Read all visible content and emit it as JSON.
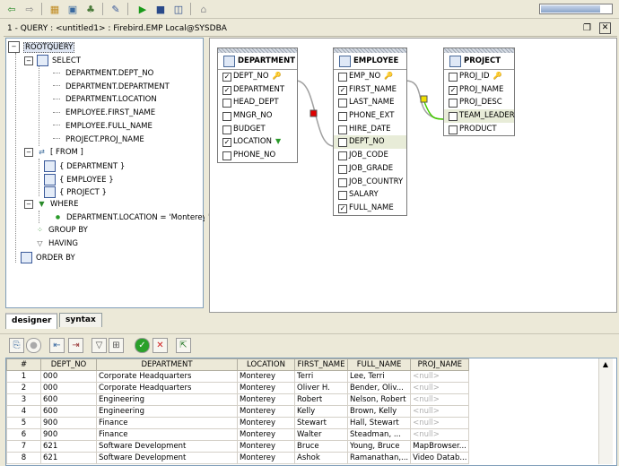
{
  "toolbar": {
    "icons": [
      "back-arrow-icon",
      "forward-arrow-icon",
      "open-folder-icon",
      "image-icon",
      "tree-icon",
      "wrench-icon",
      "run-icon",
      "save-icon",
      "save-all-icon",
      "lock-icon"
    ],
    "progress": 0.85
  },
  "query_title": "1 - QUERY : <untitled1> : Firebird.EMP Local@SYSDBA",
  "tree": {
    "root": "ROOTQUERY",
    "select_label": "SELECT",
    "select_items": [
      "DEPARTMENT.DEPT_NO",
      "DEPARTMENT.DEPARTMENT",
      "DEPARTMENT.LOCATION",
      "EMPLOYEE.FIRST_NAME",
      "EMPLOYEE.FULL_NAME",
      "PROJECT.PROJ_NAME"
    ],
    "from_label": "[ FROM ]",
    "from_items": [
      "{ DEPARTMENT }",
      "{ EMPLOYEE }",
      "{ PROJECT }"
    ],
    "where_label": "WHERE",
    "where_items": [
      "DEPARTMENT.LOCATION = 'Monterey'"
    ],
    "group_by_label": "GROUP BY",
    "having_label": "HAVING",
    "order_by_label": "ORDER BY"
  },
  "tables": {
    "department": {
      "name": "DEPARTMENT",
      "fields": [
        {
          "name": "DEPT_NO",
          "checked": true,
          "key": true
        },
        {
          "name": "DEPARTMENT",
          "checked": true
        },
        {
          "name": "HEAD_DEPT",
          "checked": false
        },
        {
          "name": "MNGR_NO",
          "checked": false
        },
        {
          "name": "BUDGET",
          "checked": false
        },
        {
          "name": "LOCATION",
          "checked": true,
          "filter": true
        },
        {
          "name": "PHONE_NO",
          "checked": false
        }
      ]
    },
    "employee": {
      "name": "EMPLOYEE",
      "fields": [
        {
          "name": "EMP_NO",
          "checked": false,
          "key": true
        },
        {
          "name": "FIRST_NAME",
          "checked": true
        },
        {
          "name": "LAST_NAME",
          "checked": false
        },
        {
          "name": "PHONE_EXT",
          "checked": false
        },
        {
          "name": "HIRE_DATE",
          "checked": false
        },
        {
          "name": "DEPT_NO",
          "checked": false,
          "selected": true
        },
        {
          "name": "JOB_CODE",
          "checked": false
        },
        {
          "name": "JOB_GRADE",
          "checked": false
        },
        {
          "name": "JOB_COUNTRY",
          "checked": false
        },
        {
          "name": "SALARY",
          "checked": false
        },
        {
          "name": "FULL_NAME",
          "checked": true
        }
      ]
    },
    "project": {
      "name": "PROJECT",
      "fields": [
        {
          "name": "PROJ_ID",
          "checked": false,
          "key": true
        },
        {
          "name": "PROJ_NAME",
          "checked": true
        },
        {
          "name": "PROJ_DESC",
          "checked": false
        },
        {
          "name": "TEAM_LEADER",
          "checked": false,
          "selected": true
        },
        {
          "name": "PRODUCT",
          "checked": false
        }
      ]
    }
  },
  "joins": {
    "dept_emp_color": "#e00000",
    "emp_proj_color": "#f0e000",
    "emp_proj_line": "#44cc00"
  },
  "tabs": [
    "designer",
    "syntax"
  ],
  "results": {
    "columns": [
      "#",
      "DEPT_NO",
      "DEPARTMENT",
      "LOCATION",
      "FIRST_NAME",
      "FULL_NAME",
      "PROJ_NAME"
    ],
    "rows": [
      [
        "1",
        "000",
        "Corporate Headquarters",
        "Monterey",
        "Terri",
        "Lee, Terri",
        "<null>"
      ],
      [
        "2",
        "000",
        "Corporate Headquarters",
        "Monterey",
        "Oliver H.",
        "Bender, Oliv...",
        "<null>"
      ],
      [
        "3",
        "600",
        "Engineering",
        "Monterey",
        "Robert",
        "Nelson, Robert",
        "<null>"
      ],
      [
        "4",
        "600",
        "Engineering",
        "Monterey",
        "Kelly",
        "Brown, Kelly",
        "<null>"
      ],
      [
        "5",
        "900",
        "Finance",
        "Monterey",
        "Stewart",
        "Hall, Stewart",
        "<null>"
      ],
      [
        "6",
        "900",
        "Finance",
        "Monterey",
        "Walter",
        "Steadman, ...",
        "<null>"
      ],
      [
        "7",
        "621",
        "Software Development",
        "Monterey",
        "Bruce",
        "Young, Bruce",
        "MapBrowser..."
      ],
      [
        "8",
        "621",
        "Software Development",
        "Monterey",
        "Ashok",
        "Ramanathan,...",
        "Video Datab..."
      ]
    ]
  }
}
